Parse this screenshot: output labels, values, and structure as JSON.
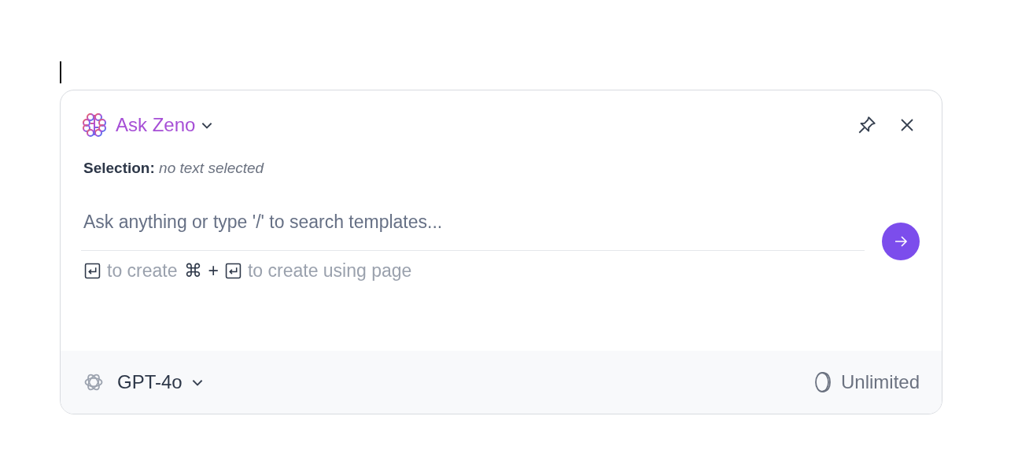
{
  "assistant": {
    "name": "Ask Zeno"
  },
  "selection": {
    "label": "Selection:",
    "value": "no text selected"
  },
  "prompt": {
    "placeholder": "Ask anything or type '/' to search templates..."
  },
  "hints": [
    {
      "kind": "key"
    },
    {
      "kind": "text",
      "text": "to create"
    },
    {
      "kind": "symbol",
      "text": "⌘"
    },
    {
      "kind": "symbol",
      "text": "+"
    },
    {
      "kind": "key"
    },
    {
      "kind": "text",
      "text": "to create using page"
    }
  ],
  "footer": {
    "model": "GPT-4o",
    "credits": "Unlimited"
  }
}
